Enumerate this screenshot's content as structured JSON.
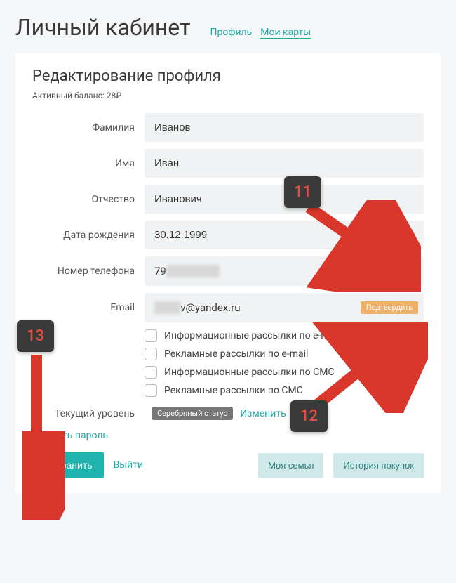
{
  "header": {
    "title": "Личный кабинет",
    "nav": {
      "profile": "Профиль",
      "cards": "Мои карты"
    }
  },
  "card": {
    "title": "Редактирование профиля",
    "balance": "Активный баланс: 28₽"
  },
  "labels": {
    "lastname": "Фамилия",
    "firstname": "Имя",
    "patronymic": "Отчество",
    "dob": "Дата рождения",
    "phone": "Номер телефона",
    "email": "Email",
    "level": "Текущий уровень"
  },
  "values": {
    "lastname": "Иванов",
    "firstname": "Иван",
    "patronymic": "Иванович",
    "dob": "30.12.1999",
    "phone_prefix": "79",
    "phone_hidden": "000000000",
    "email_hidden": "xxxxx",
    "email_visible": "v@yandex.ru"
  },
  "actions": {
    "confirm": "Подтвердить",
    "change": "Изменить",
    "change_password": "Сменить пароль",
    "save": "Сохранить",
    "logout": "Выйти",
    "family": "Моя семья",
    "history": "История покупок"
  },
  "checkboxes": {
    "info_email": "Информационные рассылки по e-mail",
    "ads_email": "Рекламные рассылки по e-mail",
    "info_sms": "Информационные рассылки по СМС",
    "ads_sms": "Рекламные рассылки по СМС"
  },
  "status": {
    "badge": "Серебряный статус"
  },
  "annotations": {
    "a11": "11",
    "a12": "12",
    "a13": "13"
  }
}
